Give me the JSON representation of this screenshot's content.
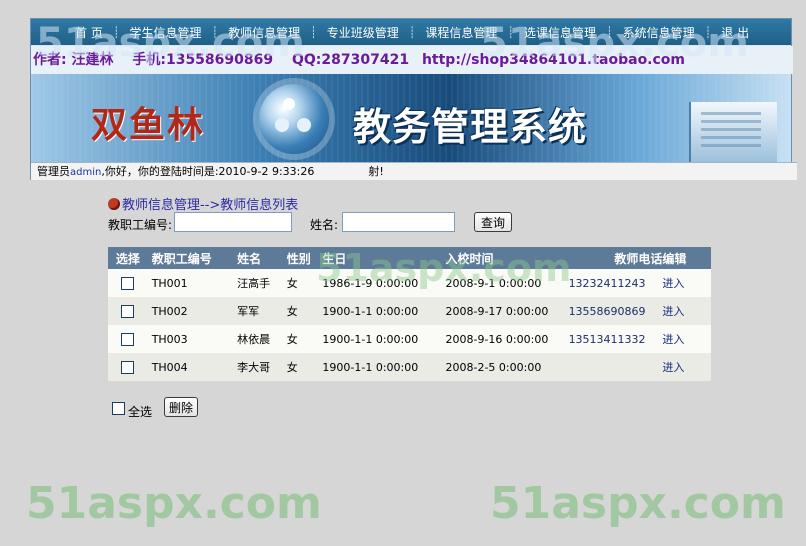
{
  "nav": {
    "items": [
      "首 页",
      "学生信息管理",
      "教师信息管理",
      "专业班级管理",
      "课程信息管理",
      "选课信息管理",
      "系统信息管理",
      "退 出"
    ],
    "separator": "┊"
  },
  "author_strip": {
    "author": "作者: 汪建林",
    "phone": "手机:13558690869",
    "qq": "QQ:287307421",
    "url": "http://shop34864101.taobao.com"
  },
  "banner": {
    "left_logo": "双鱼林",
    "title": "教务管理系统"
  },
  "status_bar": {
    "prefix": "管理员",
    "username": "admin",
    "message": ",你好，你的登陆时间是:2010-9-2 9:33:26",
    "extra": "射!"
  },
  "breadcrumb": "教师信息管理-->教师信息列表",
  "search": {
    "id_label": "教职工编号:",
    "id_value": "",
    "name_label": "姓名:",
    "name_value": "",
    "query_button": "查询"
  },
  "table": {
    "headers": [
      "选择",
      "教职工编号",
      "姓名",
      "性别",
      "生日",
      "入校时间",
      "教师电话",
      "编辑"
    ],
    "rows": [
      {
        "id": "TH001",
        "name": "汪高手",
        "sex": "女",
        "birthday": "1986-1-9 0:00:00",
        "entry": "2008-9-1 0:00:00",
        "phone": "13232411243",
        "action": "进入"
      },
      {
        "id": "TH002",
        "name": "军军",
        "sex": "女",
        "birthday": "1900-1-1 0:00:00",
        "entry": "2008-9-17 0:00:00",
        "phone": "13558690869",
        "action": "进入"
      },
      {
        "id": "TH003",
        "name": "林依晨",
        "sex": "女",
        "birthday": "1900-1-1 0:00:00",
        "entry": "2008-9-16 0:00:00",
        "phone": "13513411332",
        "action": "进入"
      },
      {
        "id": "TH004",
        "name": "李大哥",
        "sex": "女",
        "birthday": "1900-1-1 0:00:00",
        "entry": "2008-2-5 0:00:00",
        "phone": "",
        "action": "进入"
      }
    ]
  },
  "footer": {
    "select_all": "全选",
    "delete_button": "删除"
  },
  "watermark": "51aspx.com"
}
